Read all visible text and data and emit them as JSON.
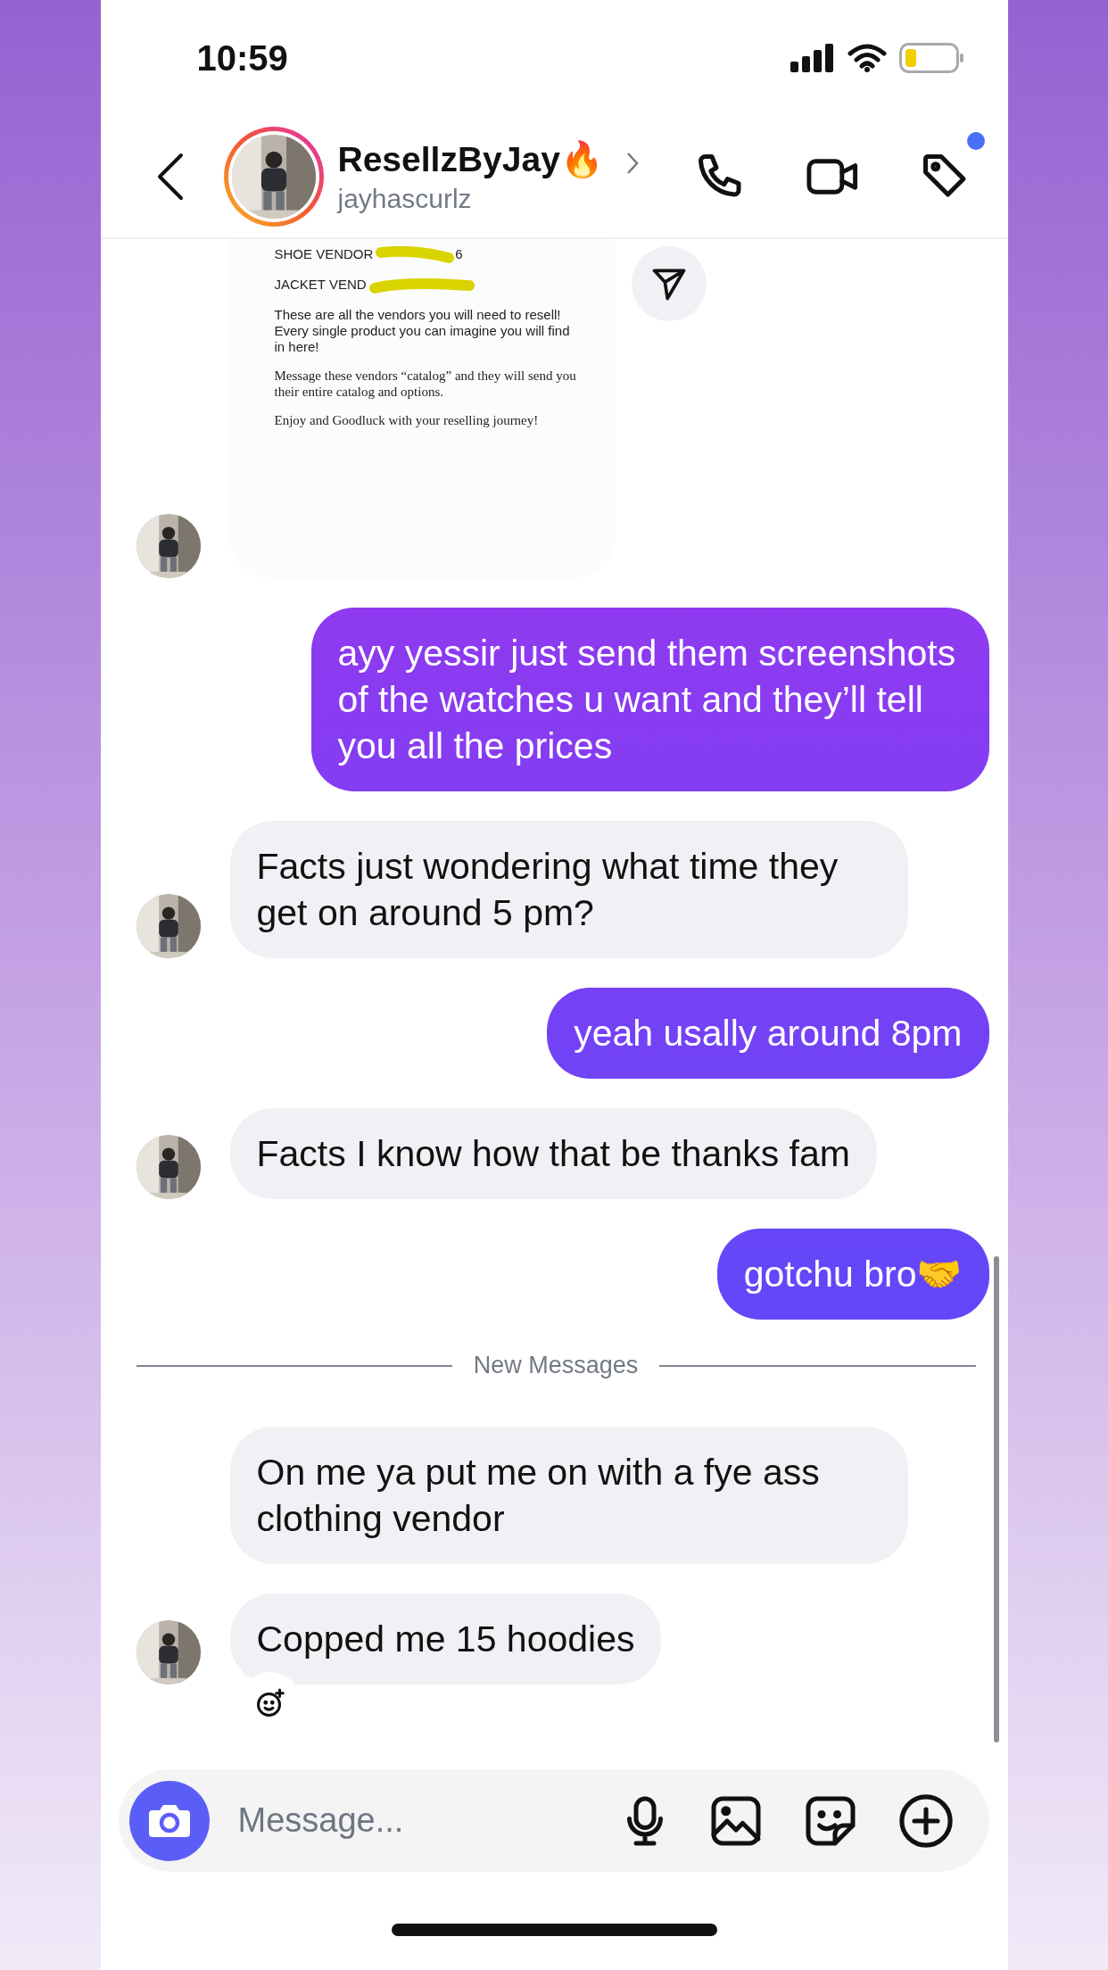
{
  "status_bar": {
    "time": "10:59"
  },
  "header": {
    "name": "ResellzByJay🔥",
    "username": "jayhascurlz"
  },
  "messages": [
    {
      "kind": "document",
      "avatar": true,
      "lines": [
        {
          "kind": "sans",
          "text": "SHOE VENDOR",
          "tail": "6",
          "redacted": true
        },
        {
          "kind": "sans",
          "text": "JACKET VEND",
          "redacted": true
        },
        {
          "kind": "sans",
          "text": "These are all the vendors you will need to resell! Every single product you can imagine you will find in here!",
          "redacted": false
        },
        {
          "kind": "serif",
          "text": "Message these vendors “catalog” and they will send you their entire catalog and options.",
          "redacted": false
        },
        {
          "kind": "serif",
          "text": "Enjoy and Goodluck with your reselling journey!",
          "redacted": false
        }
      ]
    },
    {
      "kind": "outgoing",
      "text": "ayy yessir just send them screenshots of the watches u want and they’ll tell you all the prices"
    },
    {
      "kind": "incoming",
      "avatar": true,
      "text": "Facts just wondering what time they get on around 5 pm?"
    },
    {
      "kind": "outgoing",
      "text": "yeah usally around 8pm"
    },
    {
      "kind": "incoming",
      "avatar": true,
      "text": "Facts I know how that be thanks fam"
    },
    {
      "kind": "outgoing",
      "text": "gotchu bro🤝"
    },
    {
      "kind": "divider",
      "text": "New Messages"
    },
    {
      "kind": "incoming",
      "avatar": false,
      "text": "On me ya put me on with a fye ass clothing vendor"
    },
    {
      "kind": "incoming",
      "avatar": true,
      "reaction_button": true,
      "text": "Copped me 15 hoodies"
    }
  ],
  "composer": {
    "placeholder": "Message..."
  }
}
